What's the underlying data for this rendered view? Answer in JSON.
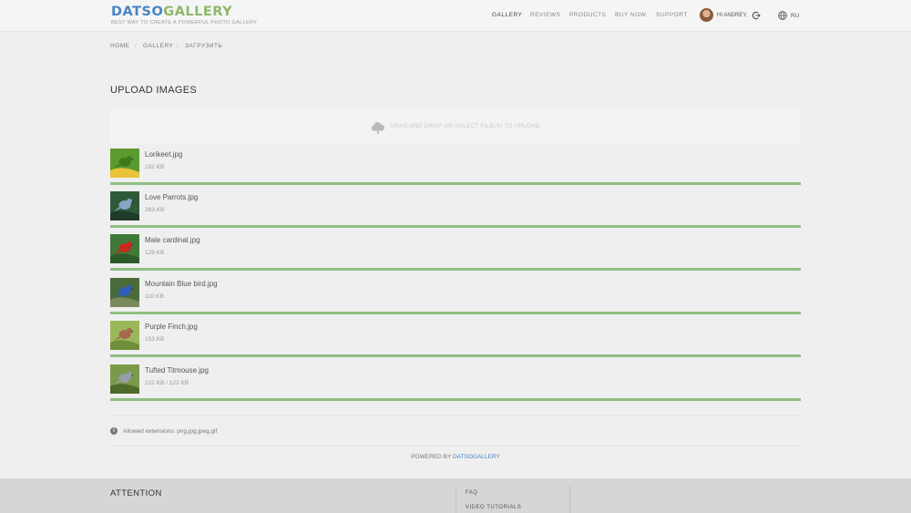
{
  "brand": {
    "logo_part1": "DATSO",
    "logo_part2": "GALLERY",
    "tagline": "BEST WAY TO CREATE A POWERFUL PHOTO GALLERY"
  },
  "nav": {
    "gallery": "GALLERY",
    "reviews": "REVIEWS",
    "products": "PRODUCTS",
    "buy_now": "BUY NOW",
    "support": "SUPPORT"
  },
  "user": {
    "greeting": "HI ANDREY,"
  },
  "language": "RU",
  "breadcrumb": {
    "home": "HOME",
    "gallery": "GALLERY",
    "current": "ЗАГРУЗИТЬ"
  },
  "page_title": "UPLOAD IMAGES",
  "dropzone": {
    "text": "DRAG AND DROP OR SELECT FILE(S) TO UPLOAD"
  },
  "files": [
    {
      "name": "Lorikeet.jpg",
      "size": "192 KB",
      "progress": 1.0,
      "thumb_colors": [
        "#5a9a2e",
        "#3e7a1c",
        "#e8c43a"
      ]
    },
    {
      "name": "Love Parrots.jpg",
      "size": "263 KB",
      "progress": 1.0,
      "thumb_colors": [
        "#2e5a38",
        "#86a6c6",
        "#1f3b2a"
      ]
    },
    {
      "name": "Male cardinal.jpg",
      "size": "129 KB",
      "progress": 1.0,
      "thumb_colors": [
        "#3f7a38",
        "#c8281e",
        "#2d5a2a"
      ]
    },
    {
      "name": "Mountain Blue bird.jpg",
      "size": "110 KB",
      "progress": 1.0,
      "thumb_colors": [
        "#4a6a3a",
        "#2e5eb8",
        "#7a8a5a"
      ]
    },
    {
      "name": "Purple Finch.jpg",
      "size": "153 KB",
      "progress": 1.0,
      "thumb_colors": [
        "#9ab85a",
        "#a8684e",
        "#6f8f3a"
      ]
    },
    {
      "name": "Tufted Titmouse.jpg",
      "size": "122 KB / 122 KB",
      "progress": 1.0,
      "thumb_colors": [
        "#7a9a4a",
        "#9a9aa8",
        "#4f6a2a"
      ]
    }
  ],
  "allowed_extensions": "Allowed extensions: png,jpg,jpeg,gif",
  "powered": {
    "prefix": "POWERED BY",
    "brand": "DATSOGALLERY"
  },
  "footer": {
    "attention": "ATTENTION",
    "links": [
      "FAQ",
      "VIDEO TUTORIALS"
    ]
  },
  "colors": {
    "accent_blue": "#4a84c4",
    "accent_green": "#8db86b",
    "progress_green": "#8fbe82"
  }
}
